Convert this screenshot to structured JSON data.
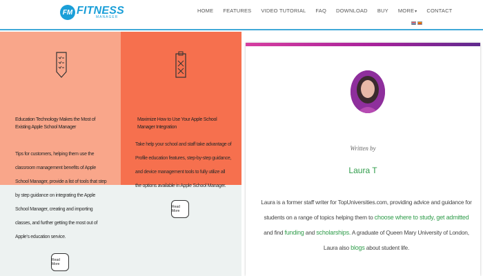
{
  "header": {
    "logo_badge": "FM",
    "logo_main": "FITNESS",
    "logo_sub": "MANAGER",
    "nav": [
      "HOME",
      "FEATURES",
      "VIDEO TUTORIAL",
      "FAQ",
      "DOWNLOAD",
      "BUY",
      "MORE",
      "CONTACT"
    ],
    "accent_color": "#1b9fd8"
  },
  "features": [
    {
      "title": "Education Technology Makes the Most of Existing Apple School Manager",
      "description": "Tips for customers, helping them use the classroom management benefits of Apple School Manager, provide a list of tools that step by step guidance on integrating the Apple School Manager, creating and importing classes, and further getting the most out of Apple's education service.",
      "button": "Read More",
      "icon": "checklist-icon",
      "color": "#f9a68a"
    },
    {
      "title": "Maximize How to Use Your Apple School Manager Integration",
      "description": "Take help your school and staff take advantage of Profile education features, step-by-step guidance, and device management tools to fully utilize all the options available in Apple School Manager.",
      "button": "Read More",
      "icon": "clipboard-icon",
      "color": "#f6704e"
    }
  ],
  "author_card": {
    "written_by": "Written by",
    "name": "Laura T",
    "bio_1": "Laura is a former staff writer for TopUniversities.com, providing advice and guidance for students on a range of topics helping them to",
    "link_1": "choose where to study,",
    "link_2": "get admitted",
    "bio_2": "and find",
    "link_3": "funding",
    "bio_3": "and",
    "link_4": "scholarships.",
    "bio_4": "A graduate of Queen Mary University of London, Laura also",
    "link_5": "blogs",
    "bio_5": "about student life.",
    "link_color": "#2f9c4a"
  }
}
